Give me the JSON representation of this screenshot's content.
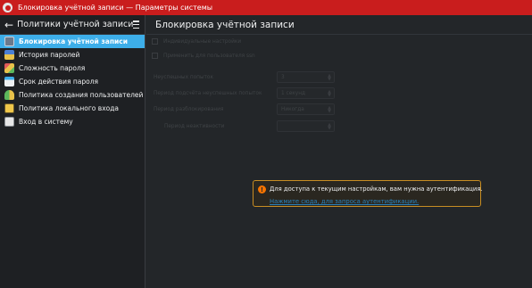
{
  "window": {
    "title": "Блокировка учётной записи  — Параметры системы"
  },
  "sidebar": {
    "title": "Политики учётной записи",
    "items": [
      {
        "label": "Блокировка учётной записи",
        "icon": "lock-icon",
        "active": true
      },
      {
        "label": "История паролей",
        "icon": "hourglass-icon",
        "active": false
      },
      {
        "label": "Сложность пароля",
        "icon": "complexity-icon",
        "active": false
      },
      {
        "label": "Срок действия пароля",
        "icon": "calendar-icon",
        "active": false
      },
      {
        "label": "Политика создания пользователей",
        "icon": "users-icon",
        "active": false
      },
      {
        "label": "Политика локального входа",
        "icon": "id-card-icon",
        "active": false
      },
      {
        "label": "Вход в систему",
        "icon": "login-icon",
        "active": false
      }
    ]
  },
  "main": {
    "title": "Блокировка учётной записи",
    "form": {
      "individual_settings": "Индивидуальные настройки",
      "apply_to_existing": "Применить для пользователя ssn",
      "failed_attempts_label": "Неуспешных попыток",
      "failed_attempts_value": "3",
      "reset_period_label": "Период подсчёта неуспешных попыток",
      "reset_period_value": "1 секунд",
      "unlock_period_label": "Период разблокирования",
      "unlock_period_value": "Никогда",
      "inactivity_label": "Период неактивности",
      "inactivity_value": ""
    },
    "notice": {
      "message": "Для доступа к текущим настройкам, вам нужна аутентификация.",
      "link": "Нажмите сюда, для запроса аутентификации."
    }
  },
  "colors": {
    "titlebar": "#c91d1d",
    "accent": "#3daee9",
    "warning": "#f67400",
    "link": "#2980b9"
  }
}
